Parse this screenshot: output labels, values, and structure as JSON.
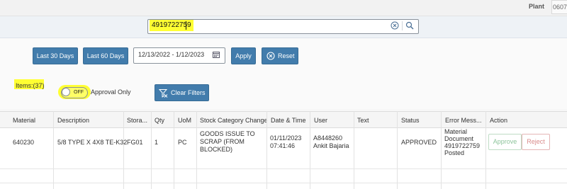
{
  "header": {
    "plant_label": "Plant",
    "plant_value": "0607"
  },
  "search": {
    "value": "4919722759"
  },
  "filters": {
    "last30_label": "Last 30 Days",
    "last60_label": "Last 60 Days",
    "date_range": "12/13/2022 - 1/12/2023",
    "apply_label": "Apply",
    "reset_label": "Reset",
    "items_count": "Items:(37)",
    "toggle_state": "OFF",
    "approval_only_label": "Approval Only",
    "clear_filters_label": "Clear Filters"
  },
  "table": {
    "columns": [
      "Material",
      "Description",
      "Stora...",
      "Qty",
      "UoM",
      "Stock Category Change",
      "Date & Time",
      "User",
      "Text",
      "Status",
      "Error Mess...",
      "Action"
    ],
    "rows": [
      {
        "material": "640230",
        "description": "5/8 TYPE X 4X8 TE-K32",
        "storage": "FG01",
        "qty": "1",
        "uom": "PC",
        "stock_change_l1": "GOODS ISSUE TO",
        "stock_change_l2": "SCRAP (FROM",
        "stock_change_l3": "BLOCKED)",
        "date": "01/11/2023",
        "time": "07:41:46",
        "user_id": "A8448260",
        "user_name": "Ankit Bajaria",
        "text": "",
        "status": "APPROVED",
        "error_l1": "Material",
        "error_l2": "Document",
        "error_l3": "4919722759",
        "error_l4": "Posted",
        "approve_label": "Approve",
        "reject_label": "Reject"
      }
    ]
  },
  "colors": {
    "accent": "#427cac",
    "highlight": "#ffff33",
    "approve_text": "#8dc49b",
    "reject_text": "#d98a8a"
  }
}
